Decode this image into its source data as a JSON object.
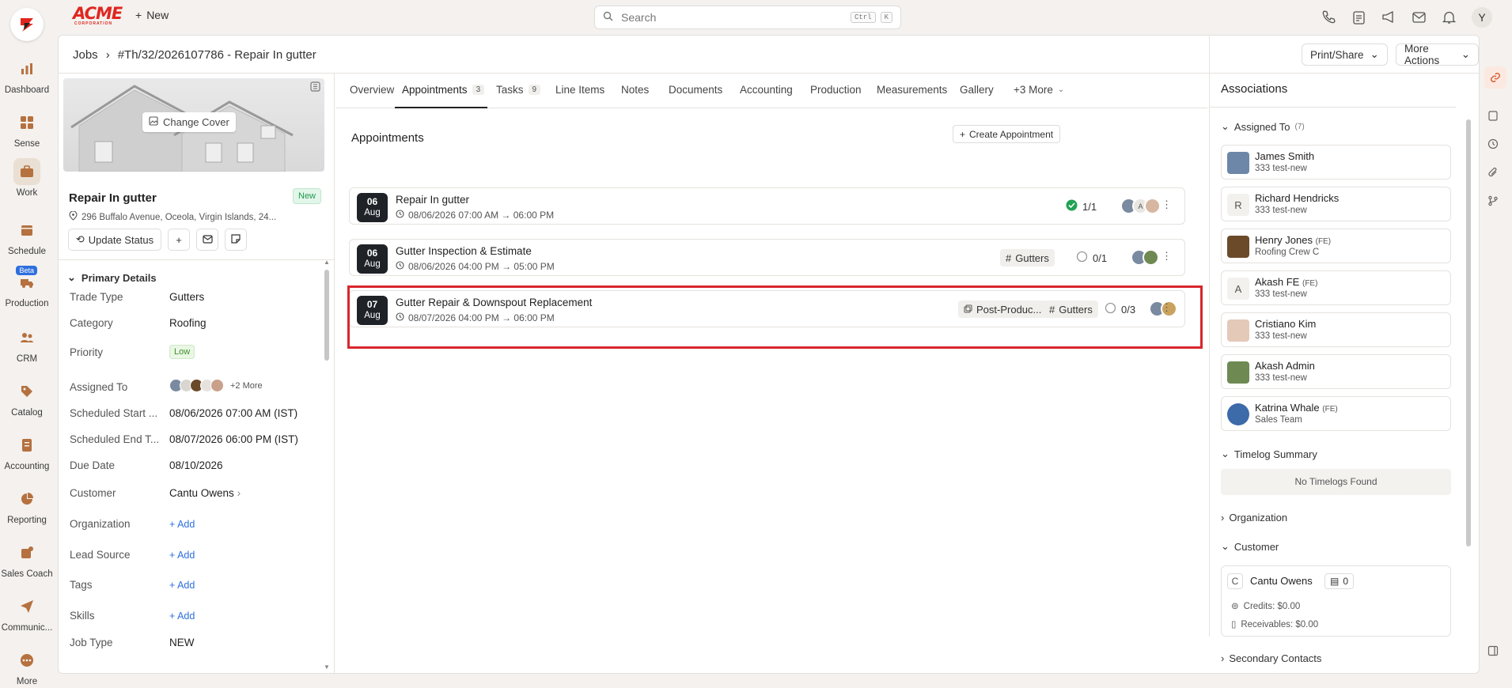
{
  "nav": {
    "items": [
      {
        "label": "Dashboard"
      },
      {
        "label": "Sense"
      },
      {
        "label": "Work"
      },
      {
        "label": "Schedule"
      },
      {
        "label": "Production",
        "badge": "Beta"
      },
      {
        "label": "CRM"
      },
      {
        "label": "Catalog"
      },
      {
        "label": "Accounting"
      },
      {
        "label": "Reporting"
      },
      {
        "label": "Sales Coach"
      },
      {
        "label": "Communic..."
      },
      {
        "label": "More"
      }
    ]
  },
  "topbar": {
    "logo": "ACME",
    "logo_sub": "CORPORATION",
    "new_label": "New",
    "search_placeholder": "Search",
    "kbd1": "Ctrl",
    "kbd2": "K",
    "user_initial": "Y"
  },
  "breadcrumb": {
    "root": "Jobs",
    "current": "#Th/32/2026107786 - Repair In gutter"
  },
  "header_actions": {
    "print": "Print/Share",
    "more": "More Actions"
  },
  "job": {
    "change_cover": "Change Cover",
    "title": "Repair In gutter",
    "status": "New",
    "address": "296 Buffalo Avenue, Oceola, Virgin Islands, 24...",
    "update_status": "Update Status"
  },
  "details": {
    "section": "Primary Details",
    "fields": [
      {
        "label": "Trade Type",
        "value": "Gutters"
      },
      {
        "label": "Category",
        "value": "Roofing"
      },
      {
        "label": "Priority",
        "value": "Low"
      },
      {
        "label": "Assigned To",
        "value": "+2 More"
      },
      {
        "label": "Scheduled Start ...",
        "value": "08/06/2026 07:00 AM (IST)"
      },
      {
        "label": "Scheduled End T...",
        "value": "08/07/2026 06:00 PM (IST)"
      },
      {
        "label": "Due Date",
        "value": "08/10/2026"
      },
      {
        "label": "Customer",
        "value": "Cantu Owens"
      },
      {
        "label": "Organization",
        "value": "Add"
      },
      {
        "label": "Lead Source",
        "value": "Add"
      },
      {
        "label": "Tags",
        "value": "Add"
      },
      {
        "label": "Skills",
        "value": "Add"
      },
      {
        "label": "Job Type",
        "value": "NEW"
      }
    ]
  },
  "tabs": [
    {
      "label": "Overview",
      "count": ""
    },
    {
      "label": "Appointments",
      "count": "3"
    },
    {
      "label": "Tasks",
      "count": "9"
    },
    {
      "label": "Line Items",
      "count": ""
    },
    {
      "label": "Notes",
      "count": ""
    },
    {
      "label": "Documents",
      "count": ""
    },
    {
      "label": "Accounting",
      "count": ""
    },
    {
      "label": "Production",
      "count": ""
    },
    {
      "label": "Measurements",
      "count": ""
    },
    {
      "label": "Gallery",
      "count": ""
    },
    {
      "label": "+3 More",
      "count": ""
    }
  ],
  "appointments": {
    "heading": "Appointments",
    "create": "Create Appointment",
    "items": [
      {
        "day": "06",
        "month": "Aug",
        "title": "Repair In gutter",
        "time": "08/06/2026 07:00 AM → 06:00 PM",
        "progress": "1/1",
        "tags": []
      },
      {
        "day": "06",
        "month": "Aug",
        "title": "Gutter Inspection & Estimate",
        "time": "08/06/2026 04:00 PM → 05:00 PM",
        "progress": "0/1",
        "tags": [
          "Gutters"
        ]
      },
      {
        "day": "07",
        "month": "Aug",
        "title": "Gutter Repair & Downspout Replacement",
        "time": "08/07/2026 04:00 PM → 06:00 PM",
        "progress": "0/3",
        "tags": [
          "Post-Produc...",
          "Gutters"
        ]
      }
    ]
  },
  "associations": {
    "title": "Associations",
    "assigned_label": "Assigned To",
    "assigned_count": "(7)",
    "people": [
      {
        "name": "James Smith",
        "fe": "",
        "sub": "333 test-new",
        "initial": ""
      },
      {
        "name": "Richard Hendricks",
        "fe": "",
        "sub": "333 test-new",
        "initial": "R"
      },
      {
        "name": "Henry Jones",
        "fe": "(FE)",
        "sub": "Roofing Crew C",
        "initial": ""
      },
      {
        "name": "Akash FE",
        "fe": "(FE)",
        "sub": "333 test-new",
        "initial": "A"
      },
      {
        "name": "Cristiano Kim",
        "fe": "",
        "sub": "333 test-new",
        "initial": ""
      },
      {
        "name": "Akash Admin",
        "fe": "",
        "sub": "333 test-new",
        "initial": ""
      },
      {
        "name": "Katrina Whale",
        "fe": "(FE)",
        "sub": "Sales Team",
        "initial": ""
      }
    ],
    "timelog_label": "Timelog Summary",
    "timelog_empty": "No Timelogs Found",
    "organization_label": "Organization",
    "customer_label": "Customer",
    "customer_initial": "C",
    "customer_name": "Cantu Owens",
    "customer_docs": "0",
    "credits": "Credits: $0.00",
    "receivables": "Receivables: $0.00",
    "secondary_label": "Secondary Contacts"
  },
  "colors": {
    "accent": "#b5713f",
    "highlight": "#d8262c",
    "link": "#2f6fde"
  }
}
